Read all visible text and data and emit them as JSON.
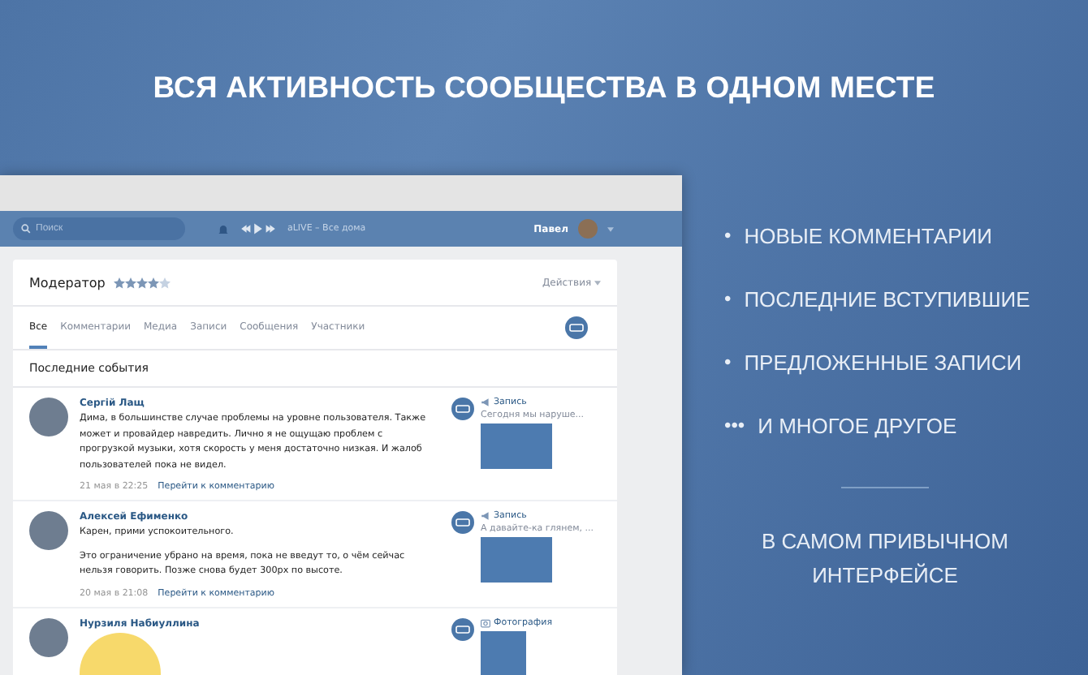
{
  "headline": "ВСЯ АКТИВНОСТЬ СООБЩЕСТВА В ОДНОМ МЕСТЕ",
  "topbar": {
    "search": {
      "placeholder": "Поиск"
    },
    "track": "aLIVE – Все дома",
    "user": "Павел"
  },
  "card": {
    "title": "Модератор",
    "stars": 4,
    "actions": "Действия",
    "tabs": [
      {
        "label": "Все",
        "selected": true
      },
      {
        "label": "Комментарии",
        "selected": false
      },
      {
        "label": "Медиа",
        "selected": false
      },
      {
        "label": "Записи",
        "selected": false
      },
      {
        "label": "Сообщения",
        "selected": false
      },
      {
        "label": "Участники",
        "selected": false
      }
    ],
    "section_title": "Последние события",
    "events": [
      {
        "author": "Сергій Лащ",
        "paragraphs": [
          "Дима, в большинстве случае проблемы на уровне пользователя. Также может и провайдер навредить. Лично я не ощущаю проблем с прогрузкой музыки, хотя скорость у меня достаточно низкая. И жалоб пользователей пока не видел."
        ],
        "date": "21 мая в 22:25",
        "link": "Перейти к комментарию",
        "target": {
          "kind": "post",
          "label": "Запись",
          "snippet": "Сегодня мы наруше..."
        }
      },
      {
        "author": "Алексей Ефименко",
        "paragraphs": [
          "Карен, прими успокоительного.",
          "Это ограничение убрано на время, пока не введут то, о чём сейчас нельзя говорить. Позже снова будет 300px по высоте."
        ],
        "date": "20 мая в 21:08",
        "link": "Перейти к комментарию",
        "target": {
          "kind": "post",
          "label": "Запись",
          "snippet": "А давайте-ка глянем, ..."
        }
      },
      {
        "author": "Нурзиля Набиуллина",
        "sticker": true,
        "target": {
          "kind": "photo",
          "label": "Фотография"
        }
      }
    ]
  },
  "features": [
    {
      "bullet": "•",
      "text": "НОВЫЕ КОММЕНТАРИИ"
    },
    {
      "bullet": "•",
      "text": "ПОСЛЕДНИЕ ВСТУПИВШИЕ"
    },
    {
      "bullet": "•",
      "text": "ПРЕДЛОЖЕННЫЕ ЗАПИСИ"
    },
    {
      "bullet": "•••",
      "text": "И МНОГОЕ ДРУГОЕ"
    }
  ],
  "tagline": "В САМОМ ПРИВЫЧНОМ ИНТЕРФЕЙСЕ"
}
